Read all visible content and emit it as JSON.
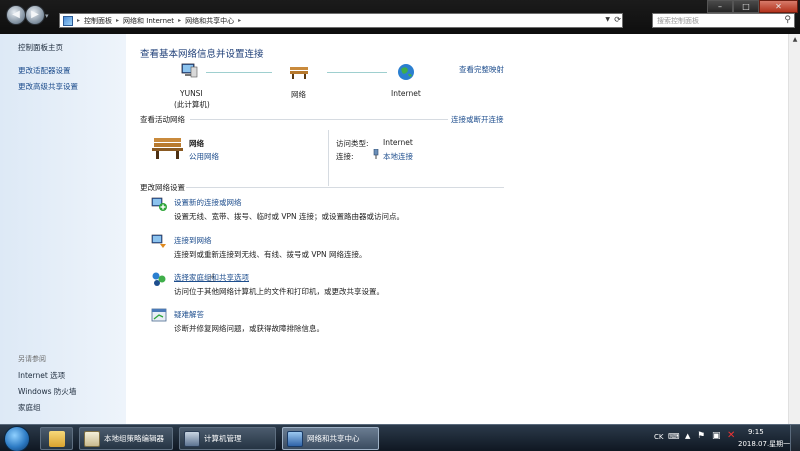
{
  "window": {
    "address": [
      "控制面板",
      "网络和 Internet",
      "网络和共享中心"
    ],
    "search_placeholder": "搜索控制面板",
    "controls": {
      "minimize": "–",
      "maximize": "□",
      "close": "✕"
    }
  },
  "sidebar": {
    "home": "控制面板主页",
    "links": [
      "更改适配器设置",
      "更改高级共享设置"
    ],
    "see_also_heading": "另请参阅",
    "see_also": [
      "Internet 选项",
      "Windows 防火墙",
      "家庭组"
    ]
  },
  "main": {
    "title": "查看基本网络信息并设置连接",
    "full_map": "查看完整映射",
    "map": {
      "computer_name": "YUNSI",
      "computer_note": "(此计算机)",
      "network": "网络",
      "internet": "Internet"
    },
    "active_heading": "查看活动网络",
    "connect_disconnect": "连接或断开连接",
    "active": {
      "name": "网络",
      "type": "公用网络",
      "access_label": "访问类型:",
      "access_value": "Internet",
      "conn_label": "连接:",
      "conn_value": "本地连接"
    },
    "change_heading": "更改网络设置",
    "tasks": [
      {
        "title": "设置新的连接或网络",
        "desc": "设置无线、宽带、拨号、临时或 VPN 连接；或设置路由器或访问点。"
      },
      {
        "title": "连接到网络",
        "desc": "连接到或重新连接到无线、有线、拨号或 VPN 网络连接。"
      },
      {
        "title": "选择家庭组和共享选项",
        "desc": "访问位于其他网络计算机上的文件和打印机，或更改共享设置。"
      },
      {
        "title": "疑难解答",
        "desc": "诊断并修复网络问题，或获得故障排除信息。"
      }
    ]
  },
  "taskbar": {
    "tasks": [
      "本地组策略编辑器",
      "计算机管理",
      "网络和共享中心"
    ],
    "lang": "CK",
    "time": "9:15",
    "date": "2018.07.星期一"
  }
}
